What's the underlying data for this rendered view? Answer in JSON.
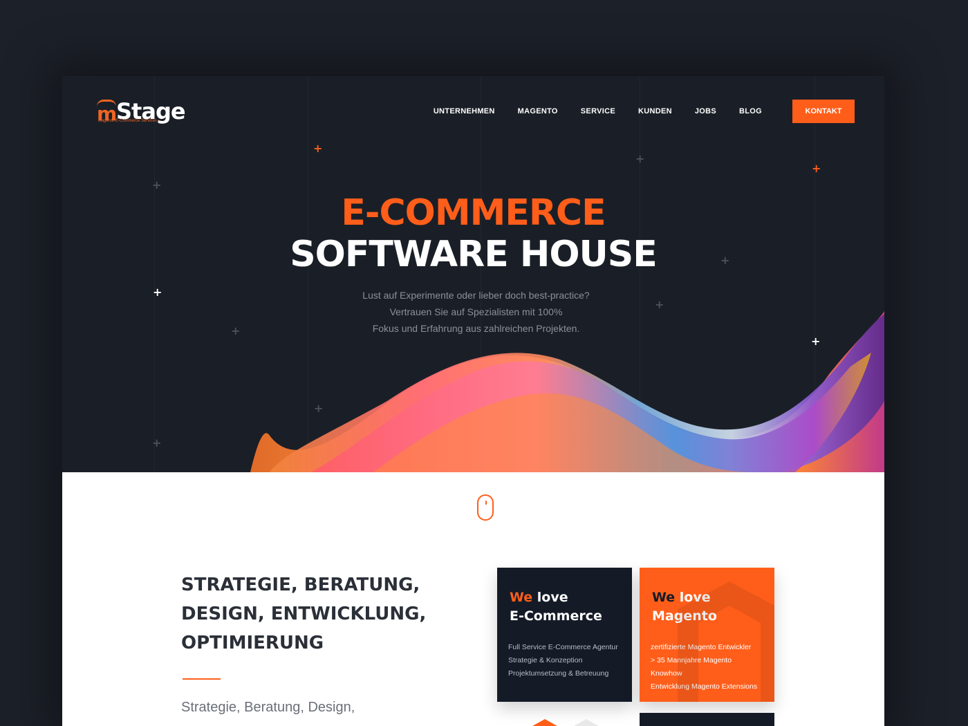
{
  "brand": {
    "logo_m": "m",
    "logo_stage": "Stage",
    "logo_tagline": "Magento E-Commerce Services",
    "accent": "#ff5e1a",
    "dark": "#1a1f27"
  },
  "nav": {
    "items": [
      "UNTERNEHMEN",
      "MAGENTO",
      "SERVICE",
      "KUNDEN",
      "JOBS",
      "BLOG"
    ],
    "cta": "KONTAKT"
  },
  "hero": {
    "title_line1": "E-COMMERCE",
    "title_line2": "SOFTWARE HOUSE",
    "subtitle_lines": [
      "Lust auf Experimente oder lieber doch best-practice?",
      "Vertrauen Sie auf Spezialisten mit 100%",
      "Fokus und Erfahrung aus zahlreichen Projekten."
    ]
  },
  "scroll": {
    "icon": "mouse-scroll-icon"
  },
  "section": {
    "title_lines": [
      "STRATEGIE, BERATUNG,",
      "DESIGN, ENTWICKLUNG,",
      "OPTIMIERUNG"
    ],
    "body": "Strategie, Beratung, Design,"
  },
  "cards": [
    {
      "lead": "We",
      "rest": " love",
      "line2": "E-Commerce",
      "lines": [
        "Full Service E-Commerce Agentur",
        "Strategie & Konzeption",
        "Projektumsetzung & Betreuung"
      ]
    },
    {
      "lead": "We",
      "rest": " love",
      "line2": "Magento",
      "lines": [
        "zertifizierte Magento Entwickler",
        "> 35 Mannjahre Magento Knowhow",
        "Entwicklung Magento Extensions"
      ]
    }
  ]
}
